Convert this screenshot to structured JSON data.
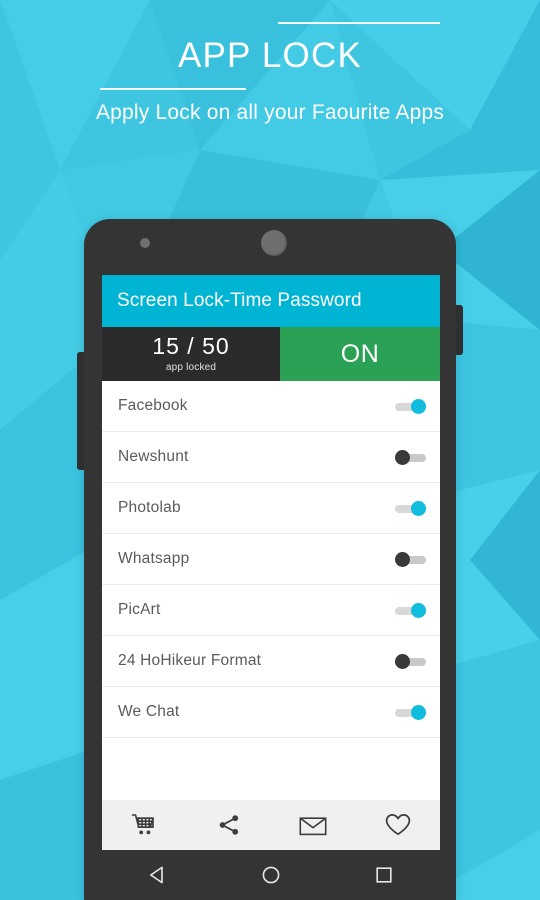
{
  "promo": {
    "title": "APP LOCK",
    "subtitle": "Apply Lock on all your Faourite Apps"
  },
  "phone": {
    "app_bar": {
      "title": "Screen Lock-Time Password"
    },
    "stats": {
      "count": "15 / 50",
      "label": "app locked",
      "toggle_state": "ON"
    },
    "apps": [
      {
        "name": "Facebook",
        "locked": true,
        "toggle": "on"
      },
      {
        "name": "Newshunt",
        "locked": false,
        "toggle": "off"
      },
      {
        "name": "Photolab",
        "locked": true,
        "toggle": "on"
      },
      {
        "name": "Whatsapp",
        "locked": false,
        "toggle": "off"
      },
      {
        "name": "PicArt",
        "locked": true,
        "toggle": "on"
      },
      {
        "name": "24 HoHikeur Format",
        "locked": false,
        "toggle": "off"
      },
      {
        "name": "We Chat",
        "locked": true,
        "toggle": "on"
      }
    ],
    "toolbar": [
      {
        "icon": "shopping-cart-icon"
      },
      {
        "icon": "share-icon"
      },
      {
        "icon": "mail-envelope-icon"
      },
      {
        "icon": "heart-icon"
      }
    ],
    "nav_bar": [
      {
        "icon": "back-triangle-icon"
      },
      {
        "icon": "home-circle-icon"
      },
      {
        "icon": "recents-square-icon"
      }
    ]
  },
  "colors": {
    "background": "#3ec6e0",
    "app_bar": "#00b5d4",
    "stats_dark": "#2b2b2b",
    "stats_green": "#2aa155",
    "toggle_on": "#11bcdd",
    "toggle_off": "#3a3a3a",
    "phone_body": "#343434",
    "toolbar_bg": "#f0f0f0"
  }
}
